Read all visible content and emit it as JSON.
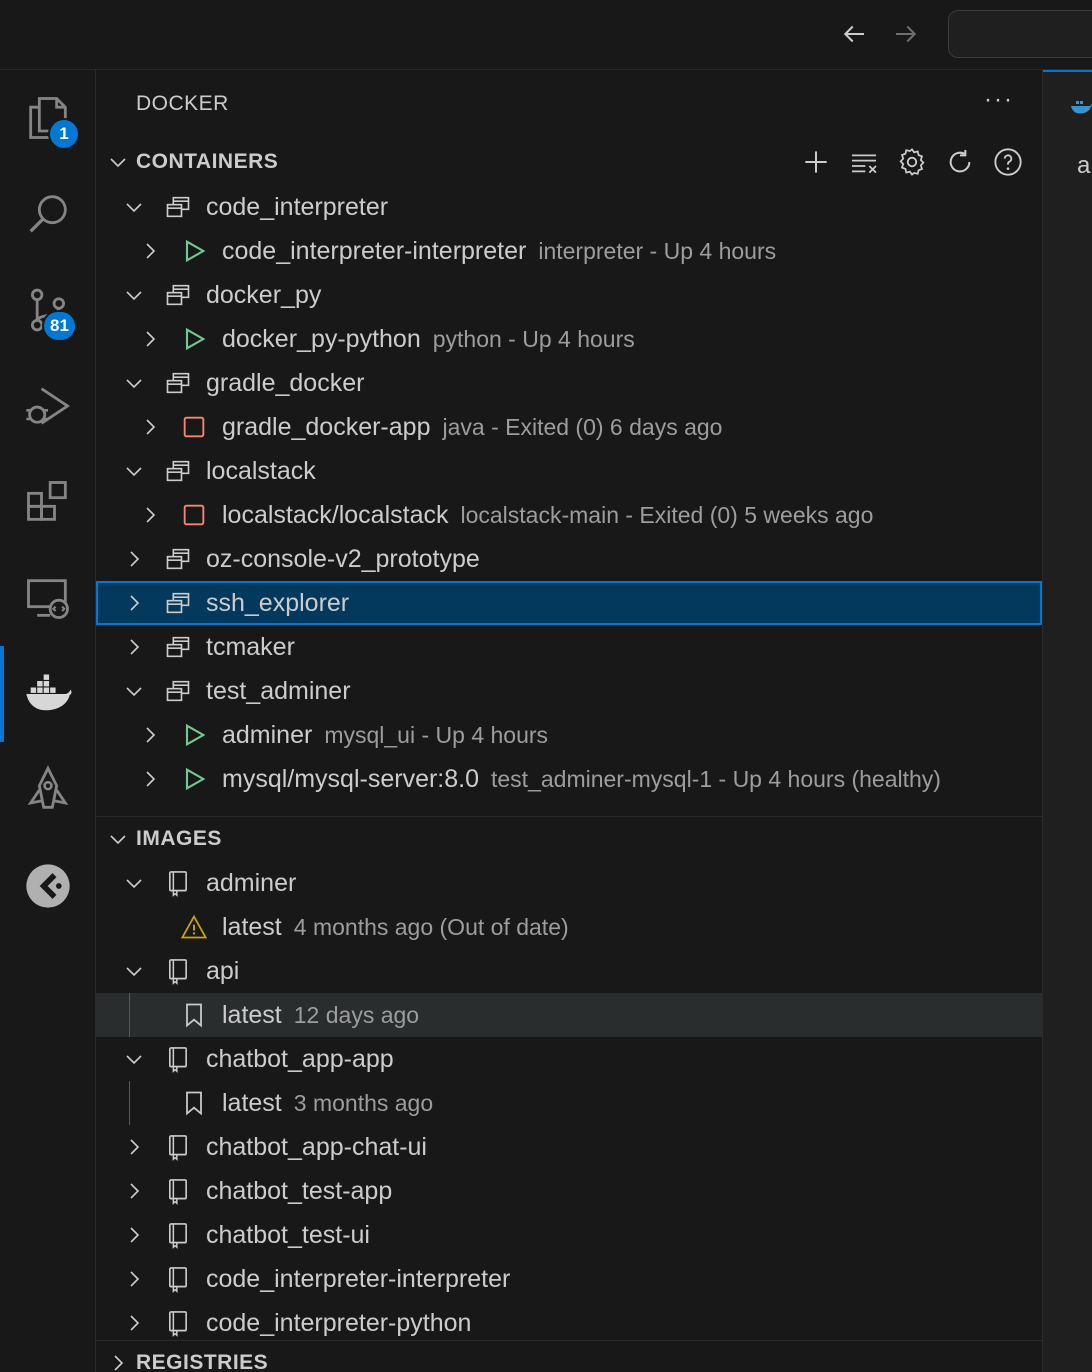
{
  "titlebar": {
    "back_icon": "arrow-left-icon",
    "forward_icon": "arrow-right-icon"
  },
  "activity": {
    "explorer_badge": "1",
    "scm_badge": "81",
    "items": [
      "files-icon",
      "search-icon",
      "source-control-icon",
      "run-debug-icon",
      "extensions-icon",
      "remote-explorer-icon",
      "docker-icon",
      "rocket-icon",
      "gitkraken-icon"
    ]
  },
  "sidebar": {
    "title": "DOCKER",
    "more": "···"
  },
  "containers": {
    "header": "CONTAINERS",
    "groups": [
      {
        "name": "code_interpreter",
        "children": [
          {
            "name": "code_interpreter-interpreter",
            "desc": "interpreter - Up 4 hours",
            "state": "running"
          }
        ]
      },
      {
        "name": "docker_py",
        "children": [
          {
            "name": "docker_py-python",
            "desc": "python - Up 4 hours",
            "state": "running"
          }
        ]
      },
      {
        "name": "gradle_docker",
        "children": [
          {
            "name": "gradle_docker-app",
            "desc": "java - Exited (0) 6 days ago",
            "state": "exited"
          }
        ]
      },
      {
        "name": "localstack",
        "children": [
          {
            "name": "localstack/localstack",
            "desc": "localstack-main - Exited (0) 5 weeks ago",
            "state": "exited"
          }
        ]
      },
      {
        "name": "oz-console-v2_prototype"
      },
      {
        "name": "ssh_explorer"
      },
      {
        "name": "tcmaker"
      },
      {
        "name": "test_adminer",
        "children": [
          {
            "name": "adminer",
            "desc": "mysql_ui - Up 4 hours",
            "state": "running"
          },
          {
            "name": "mysql/mysql-server:8.0",
            "desc": "test_adminer-mysql-1 - Up 4 hours (healthy)",
            "state": "running"
          }
        ]
      }
    ]
  },
  "images": {
    "header": "IMAGES",
    "items": [
      {
        "name": "adminer",
        "tag": "latest",
        "tag_desc": "4 months ago (Out of date)"
      },
      {
        "name": "api",
        "tag": "latest",
        "tag_desc": "12 days ago"
      },
      {
        "name": "chatbot_app-app",
        "tag": "latest",
        "tag_desc": "3 months ago"
      },
      {
        "name": "chatbot_app-chat-ui"
      },
      {
        "name": "chatbot_test-app"
      },
      {
        "name": "chatbot_test-ui"
      },
      {
        "name": "code_interpreter-interpreter"
      },
      {
        "name": "code_interpreter-python"
      }
    ]
  },
  "registries": {
    "header": "REGISTRIES"
  },
  "editor": {
    "tab_text": "a"
  }
}
